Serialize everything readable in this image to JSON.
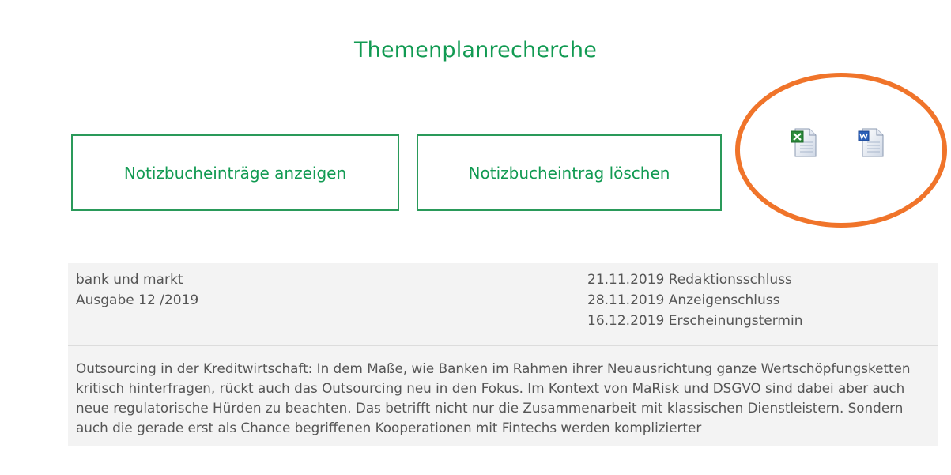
{
  "header": {
    "title": "Themenplanrecherche"
  },
  "actions": {
    "show_entries_label": "Notizbucheinträge anzeigen",
    "delete_entry_label": "Notizbucheintrag löschen"
  },
  "export_icons": [
    {
      "name": "excel-export-icon",
      "accent": "#2c8a3a"
    },
    {
      "name": "word-export-icon",
      "accent": "#2a5fb8"
    }
  ],
  "highlight_color": "#f0742a",
  "brand_color": "#119a52",
  "publication": {
    "name": "bank und markt",
    "issue": "Ausgabe 12 /2019",
    "dates": [
      "21.11.2019 Redaktionsschluss",
      "28.11.2019 Anzeigenschluss",
      "16.12.2019 Erscheinungstermin"
    ],
    "description": "Outsourcing in der Kreditwirtschaft: In dem Maße, wie Banken im Rahmen ihrer Neuausrichtung ganze Wertschöpfungsketten kritisch hinterfragen, rückt auch das Outsourcing neu in den Fokus. Im Kontext von MaRisk und DSGVO sind dabei aber auch neue regulatorische Hürden zu beachten. Das betrifft nicht nur die Zusammenarbeit mit klassischen Dienstleistern. Sondern auch die gerade erst als Chance begriffenen Kooperationen mit Fintechs werden komplizierter"
  }
}
